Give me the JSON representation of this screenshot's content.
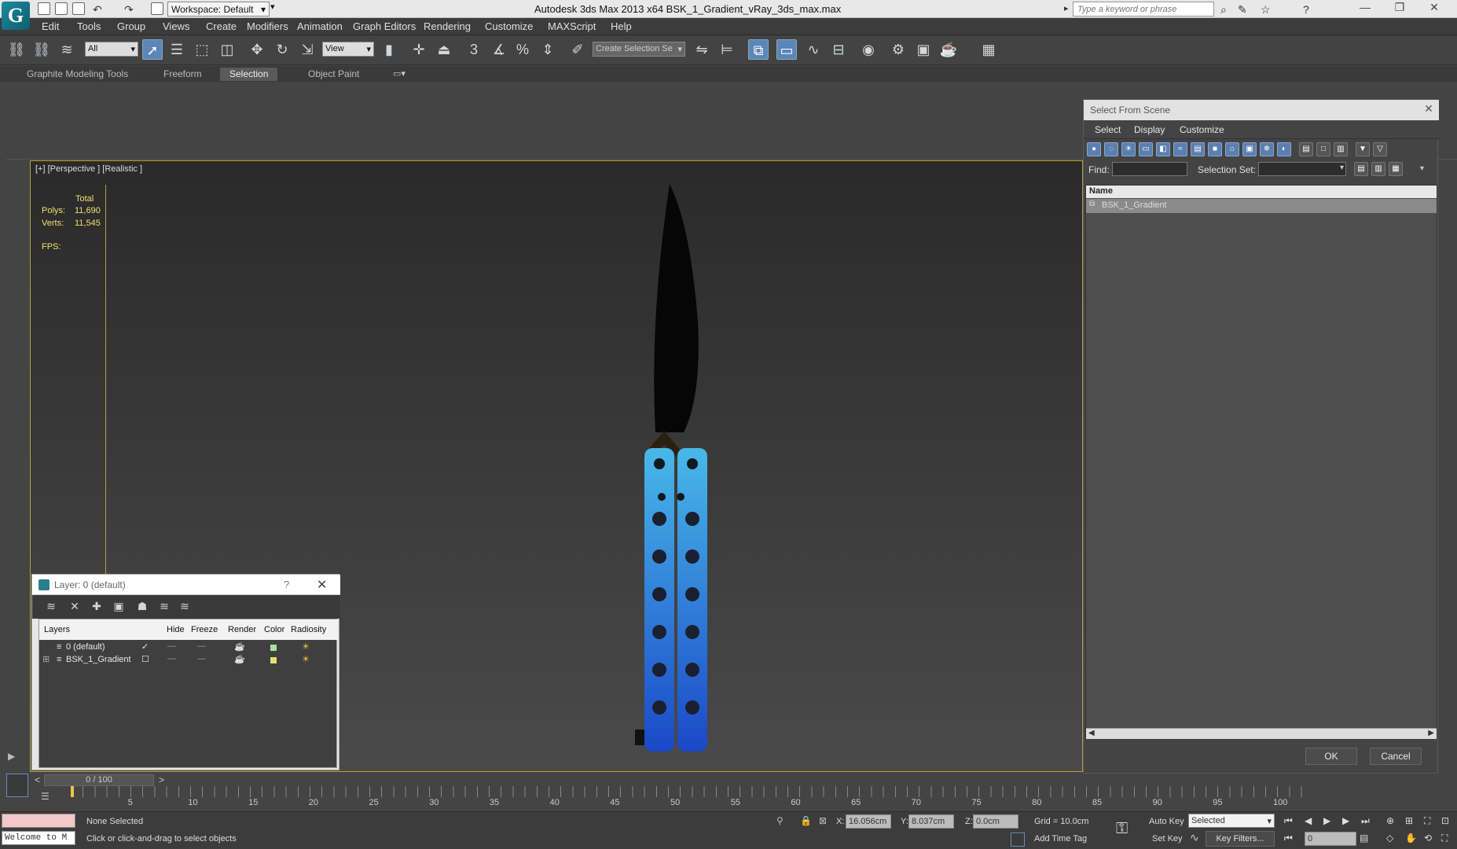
{
  "app": {
    "title": "Autodesk 3ds Max  2013 x64      BSK_1_Gradient_vRay_3ds_max.max",
    "logo_glyph": "G",
    "workspace": "Workspace: Default",
    "search_placeholder": "Type a keyword or phrase"
  },
  "menu": [
    "Edit",
    "Tools",
    "Group",
    "Views",
    "Create",
    "Modifiers",
    "Animation",
    "Graph Editors",
    "Rendering",
    "Customize",
    "MAXScript",
    "Help"
  ],
  "toolbar": {
    "filter": "All",
    "ref_coord": "View",
    "selection_set": "Create Selection Se",
    "snap_3": "3",
    "snap_pct": "%"
  },
  "ribbon": {
    "tabs": [
      "Graphite Modeling Tools",
      "Freeform",
      "Selection",
      "Object Paint"
    ],
    "active_tab": "Selection"
  },
  "viewport": {
    "label": "[+] [Perspective ] [Realistic ]",
    "stats": {
      "total": "Total",
      "polys_label": "Polys:",
      "polys_value": "11,690",
      "verts_label": "Verts:",
      "verts_value": "11,545",
      "fps_label": "FPS:"
    }
  },
  "select_from_scene": {
    "title": "Select From Scene",
    "menu": [
      "Select",
      "Display",
      "Customize"
    ],
    "find_label": "Find:",
    "selection_set_label": "Selection Set:",
    "column_name": "Name",
    "rows": [
      "BSK_1_Gradient"
    ],
    "ok": "OK",
    "cancel": "Cancel"
  },
  "layer_dialog": {
    "title": "Layer: 0 (default)",
    "help": "?",
    "columns": [
      "Layers",
      "Hide",
      "Freeze",
      "Render",
      "Color",
      "Radiosity"
    ],
    "rows": [
      {
        "name": "0 (default)",
        "color": "#a8e0a0"
      },
      {
        "name": "BSK_1_Gradient",
        "color": "#e0e070"
      }
    ]
  },
  "timeline": {
    "frame_display": "0 / 100",
    "ticks": [
      "5",
      "10",
      "15",
      "20",
      "25",
      "30",
      "35",
      "40",
      "45",
      "50",
      "55",
      "60",
      "65",
      "70",
      "75",
      "80",
      "85",
      "90",
      "95",
      "100"
    ]
  },
  "status": {
    "maxscript_text": "Welcome to M",
    "selection": "None Selected",
    "prompt": "Click or click-and-drag to select objects",
    "x_label": "X:",
    "x_value": "16.056cm",
    "y_label": "Y:",
    "y_value": "8.037cm",
    "z_label": "Z:",
    "z_value": "0.0cm",
    "grid": "Grid = 10.0cm",
    "add_time_tag": "Add Time Tag",
    "auto_key": "Auto Key",
    "auto_key_mode": "Selected",
    "set_key": "Set Key",
    "key_filters": "Key Filters...",
    "frame_field": "0"
  },
  "colors": {
    "accent": "#5a86b8",
    "viewport_border": "#b8a038",
    "stats_text": "#f0e070"
  }
}
